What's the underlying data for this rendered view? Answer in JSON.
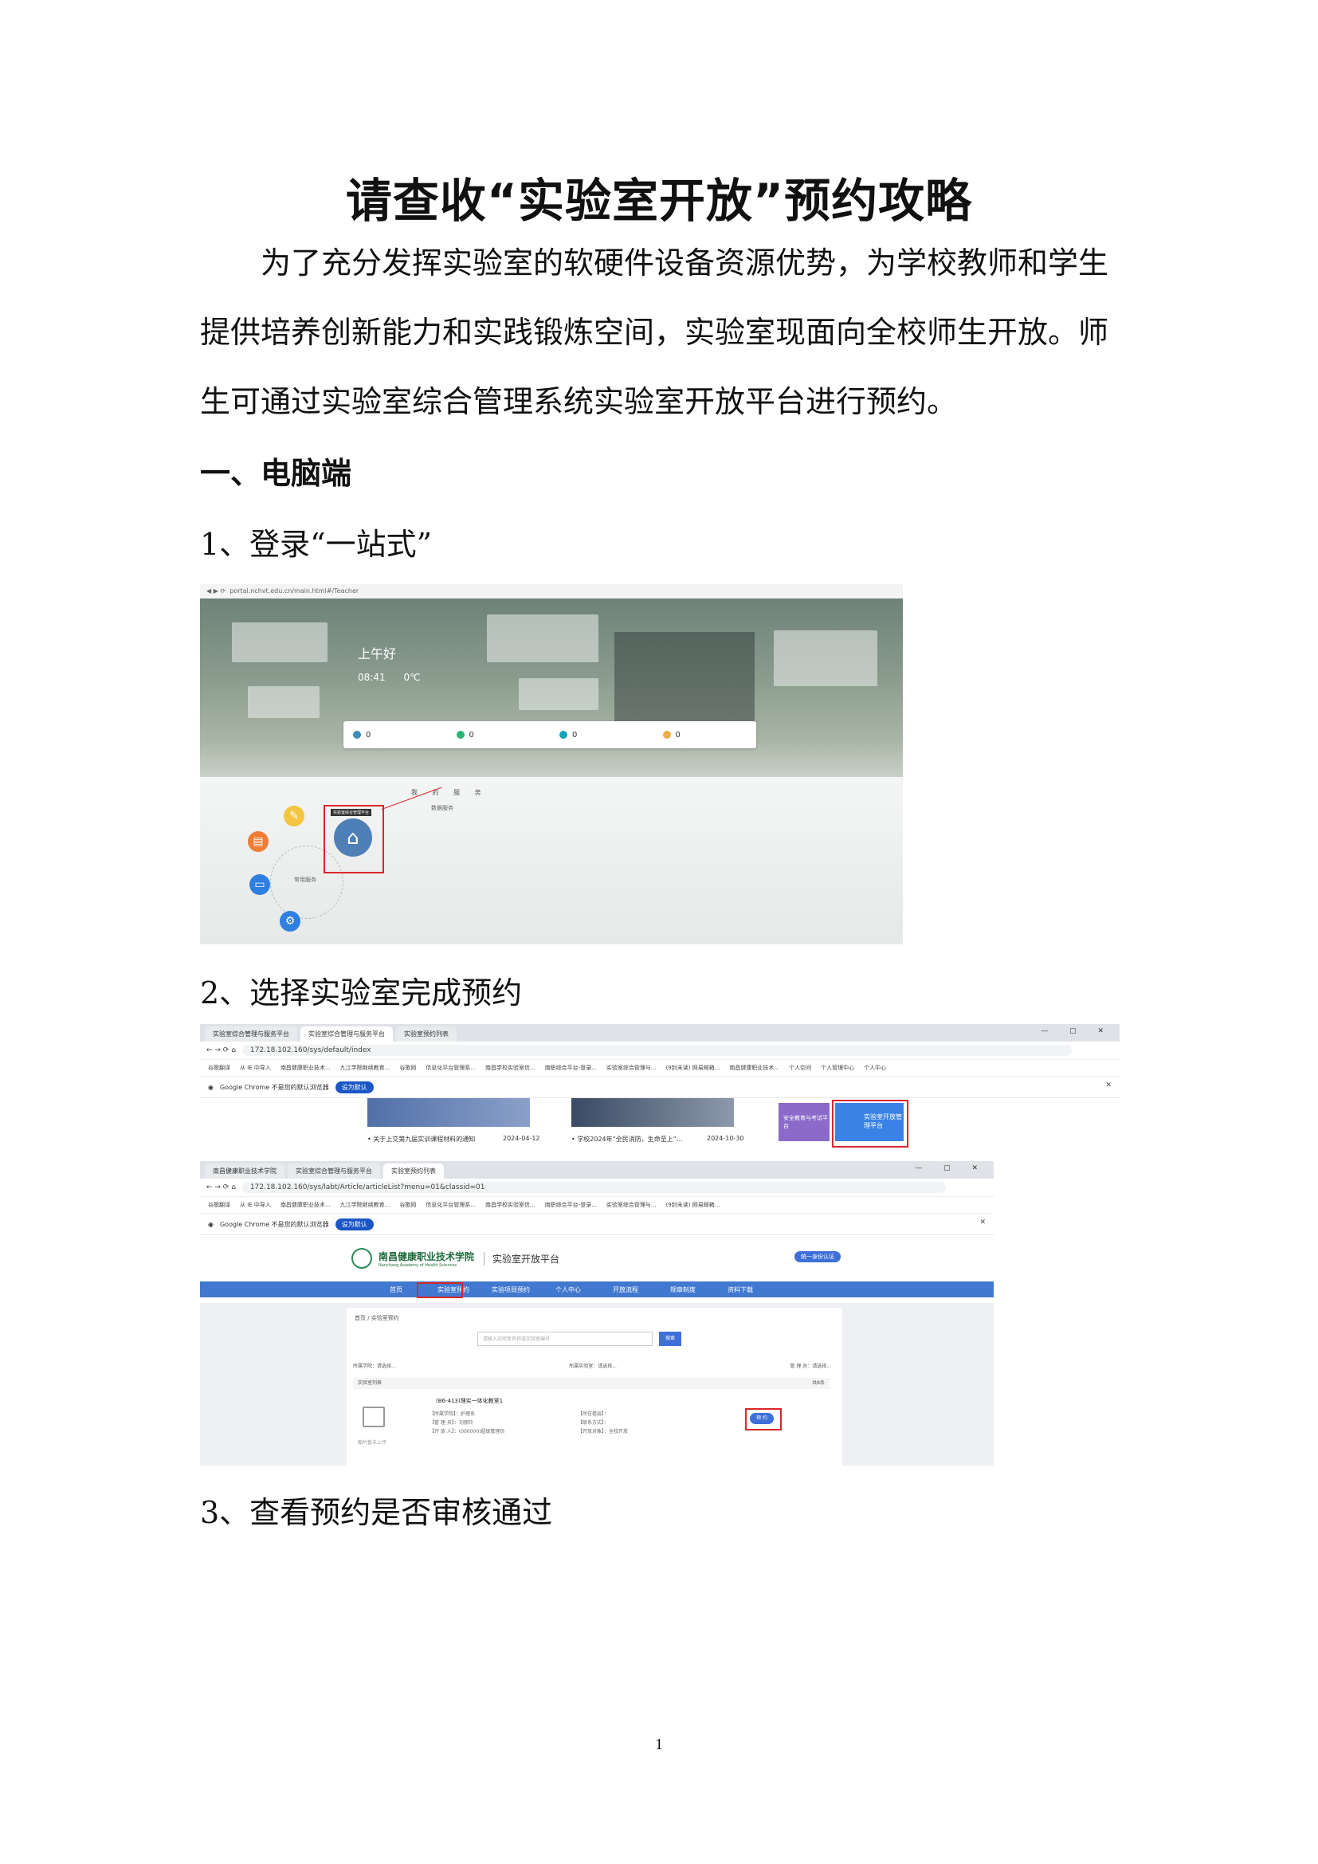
{
  "title": "请查收“实验室开放”预约攻略",
  "intro": [
    "为了充分发挥实验室的软硬件设备资源优势，为学校教师和学生",
    "提供培养创新能力和实践锻炼空间，实验室现面向全校师生开放。师",
    "生可通过实验室综合管理系统实验室开放平台进行预约。"
  ],
  "section1": "一、电脑端",
  "steps": [
    "1、登录“一站式”",
    "2、选择实验室完成预约",
    "3、查看预约是否审核通过"
  ],
  "shot1": {
    "url": "portal.nchvt.edu.cn/main.html#/Teacher",
    "greeting": "上午好",
    "time": "08:41",
    "temp": "0℃",
    "stats": [
      "0",
      "0",
      "0",
      "0"
    ],
    "tabs": "我 的 服 务",
    "sub": "数据服务",
    "common": "常用服务",
    "tooltip": "实验室综合管理平台"
  },
  "shot2": {
    "tabs": [
      "实验室综合管理与服务平台",
      "实验室综合管理与服务平台",
      "实验室预约列表"
    ],
    "url": "172.18.102.160/sys/default/index",
    "bookmarks": [
      "谷歌翻译",
      "从 IE 中导入",
      "南昌健康职业技术...",
      "九江学院继续教育...",
      "谷歌网",
      "信息化平台管理系...",
      "南昌学校实验室信...",
      "南职综合平台-登录...",
      "实验室综合管理与...",
      "(9封未读) 网易邮箱...",
      "南昌健康职业技术...",
      "个人空间",
      "个人管理中心",
      "个人中心"
    ],
    "infobar": "Google Chrome 不是您的默认浏览器",
    "infobtn": "设为默认",
    "news1": "• 关于上交第九届实训课程材料的通知",
    "date1": "2024-04-12",
    "news2": "• 学校2024年“全民消防，生命至上”...",
    "date2": "2024-10-30",
    "tile1": "安全教育与考试平台",
    "tile2": "实验室开放管理平台"
  },
  "shot3": {
    "tabs": [
      "南昌健康职业技术学院",
      "实验室综合管理与服务平台",
      "实验室预约列表"
    ],
    "url": "172.18.102.160/sys/labt/Article/articleList?menu=01&classid=01",
    "school": "南昌健康职业技术学院",
    "school_en": "Nanchang Academy of Health Sciences",
    "platform": "实验室开放平台",
    "login": "统一身份认证",
    "menu": [
      "首页",
      "实验室预约",
      "实验项目预约",
      "个人中心",
      "开放流程",
      "规章制度",
      "资料下载"
    ],
    "breadcrumb": "首页 / 实验室预约",
    "search_placeholder": "请输入实验室名称或实验室编号",
    "search_btn": "搜索",
    "filters": [
      "所属学院：请选择...",
      "所属实验室：请选择...",
      "管 理 员：请选择..."
    ],
    "list_title": "实验室列表",
    "list_count": "共8条",
    "room": "(B6-413)理实一体化教室1",
    "meta": [
      "【所属学院】：护理系",
      "【管 理 员】：刘丽玲",
      "【开 放 人】：(000000)超级管理员"
    ],
    "meta2": [
      "【所在楼层】：",
      "【联系方式】：",
      "【开放对象】：全校开放"
    ],
    "pc_label": "图片暂未上传",
    "reserve": "预 约"
  },
  "page_number": "1"
}
